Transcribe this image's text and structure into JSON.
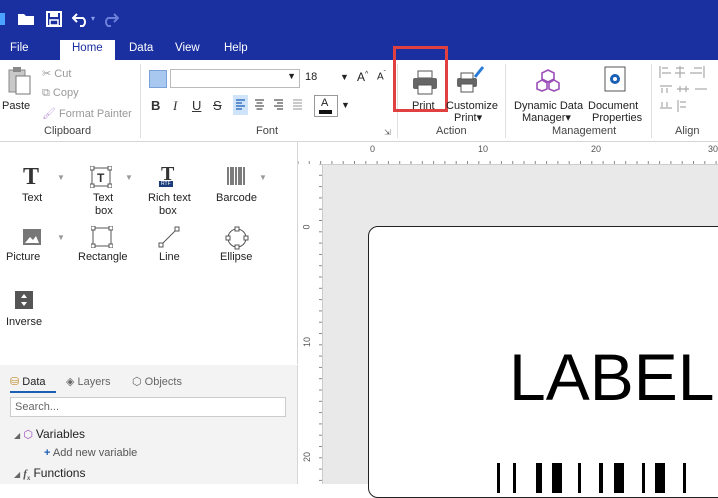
{
  "menu": [
    "File",
    "Home",
    "Data",
    "View",
    "Help"
  ],
  "clipboard": {
    "paste": "Paste",
    "cut": "Cut",
    "copy": "Copy",
    "format_painter": "Format Painter",
    "group": "Clipboard"
  },
  "font": {
    "size": "18",
    "group": "Font"
  },
  "action": {
    "print": "Print",
    "customize_print_line1": "Customize",
    "customize_print_line2": "Print",
    "group": "Action"
  },
  "management": {
    "ddm_line1": "Dynamic Data",
    "ddm_line2": "Manager",
    "doc_line1": "Document",
    "doc_line2": "Properties",
    "group": "Management"
  },
  "align": {
    "group": "Align"
  },
  "tools": {
    "text": "Text",
    "text_box_1": "Text",
    "text_box_2": "box",
    "rich_text_1": "Rich text",
    "rich_text_2": "box",
    "rtf_badge": "RTF",
    "barcode": "Barcode",
    "picture": "Picture",
    "rectangle": "Rectangle",
    "line": "Line",
    "ellipse": "Ellipse",
    "inverse": "Inverse"
  },
  "panel": {
    "tabs": [
      "Data",
      "Layers",
      "Objects"
    ],
    "search_placeholder": "Search...",
    "variables": "Variables",
    "add_variable": "Add new variable",
    "functions": "Functions"
  },
  "ruler": {
    "h": [
      "0",
      "10",
      "20",
      "30"
    ],
    "v": [
      "0",
      "10",
      "20"
    ]
  },
  "label_text": "LABEL",
  "colors": {
    "accent": "#1a2fa0",
    "highlight": "#e04040",
    "selected_align": "#cfe3fb"
  }
}
